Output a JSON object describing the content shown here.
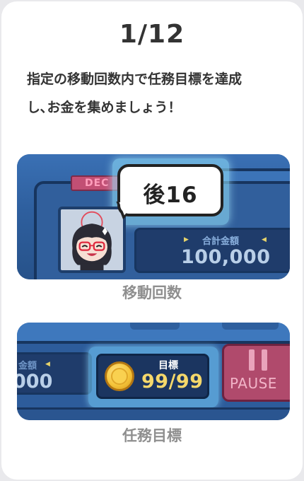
{
  "header": {
    "page_indicator": "1/12",
    "description_line1": "指定の移動回数内で任務目標を達成",
    "description_line2": "し､お金を集めましょう！"
  },
  "panel_moves": {
    "deco_label": "DEC",
    "remaining_moves": "後16",
    "total_label": "合計金額",
    "total_value": "100,000",
    "caption": "移動回数"
  },
  "panel_goal": {
    "left_label": "金額",
    "left_value": "000",
    "goal_label": "目標",
    "goal_value": "99/99",
    "pause_label": "PAUSE",
    "caption": "任務目標"
  },
  "colors": {
    "panel_blue": "#2c5a96",
    "highlight_cyan": "#96e6ff",
    "goal_gold": "#f5d86b",
    "pause_pink": "#b04a6c",
    "caption_gray": "#8f8f8f"
  },
  "icons": [
    "coin-icon",
    "pause-icon",
    "avatar-character",
    "arrow-left-icon",
    "arrow-right-icon"
  ]
}
